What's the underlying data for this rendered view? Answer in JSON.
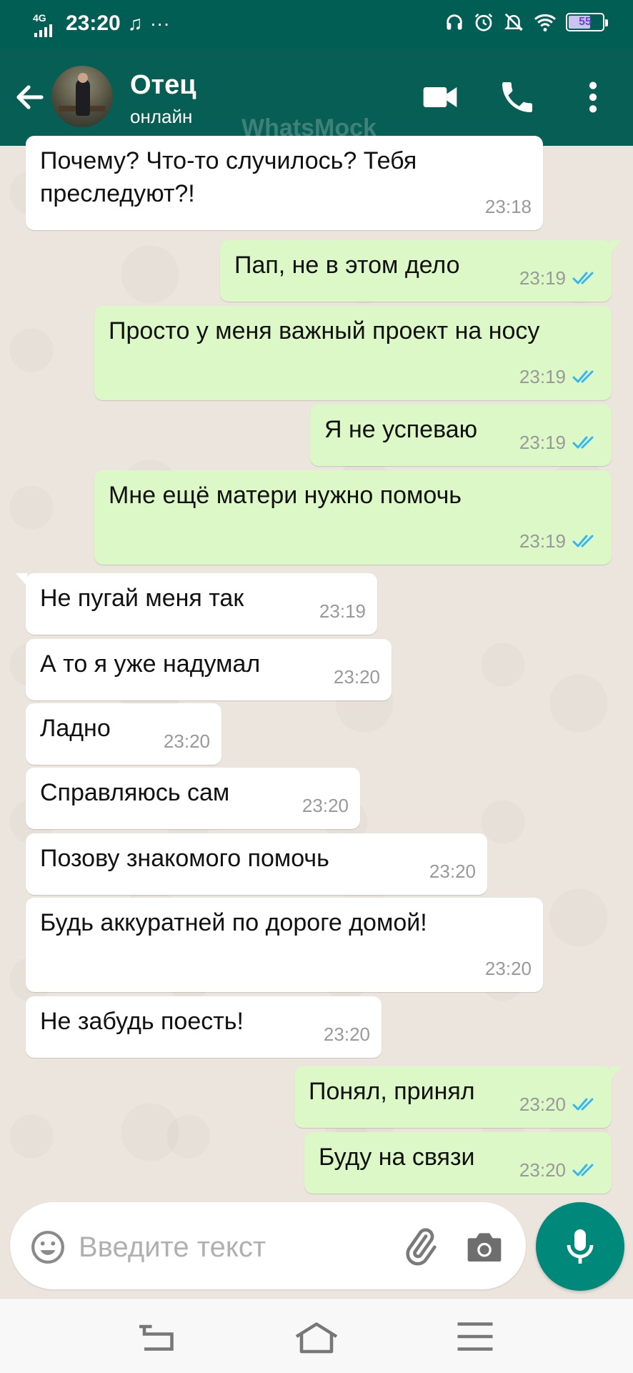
{
  "status_bar": {
    "network": "4G",
    "time": "23:20",
    "music_icon": "music-note-icon",
    "more": "···",
    "battery": "55"
  },
  "header": {
    "contact_name": "Отец",
    "contact_status": "онлайн",
    "watermark": "WhatsMock",
    "icons": [
      "back-arrow-icon",
      "video-call-icon",
      "phone-call-icon",
      "more-vertical-icon"
    ],
    "color": "#075e54"
  },
  "messages": [
    {
      "dir": "in",
      "text": "Почему? Что-то случилось? Тебя преследуют?!",
      "time": "23:18"
    },
    {
      "dir": "out",
      "text": "Пап, не в этом дело",
      "time": "23:19"
    },
    {
      "dir": "out",
      "text": "Просто у меня важный проект на носу",
      "time": "23:19"
    },
    {
      "dir": "out",
      "text": "Я не успеваю",
      "time": "23:19"
    },
    {
      "dir": "out",
      "text": "Мне ещё матери нужно помочь",
      "time": "23:19"
    },
    {
      "dir": "in",
      "text": "Не пугай меня так",
      "time": "23:19"
    },
    {
      "dir": "in",
      "text": "А то я уже надумал",
      "time": "23:20"
    },
    {
      "dir": "in",
      "text": "Ладно",
      "time": "23:20"
    },
    {
      "dir": "in",
      "text": "Справляюсь сам",
      "time": "23:20"
    },
    {
      "dir": "in",
      "text": "Позову знакомого помочь",
      "time": "23:20"
    },
    {
      "dir": "in",
      "text": "Будь аккуратней по дороге домой!",
      "time": "23:20"
    },
    {
      "dir": "in",
      "text": "Не забудь поесть!",
      "time": "23:20"
    },
    {
      "dir": "out",
      "text": "Понял, принял",
      "time": "23:20"
    },
    {
      "dir": "out",
      "text": "Буду на связи",
      "time": "23:20"
    }
  ],
  "composer": {
    "placeholder": "Введите текст",
    "icons": [
      "emoji-icon",
      "attach-icon",
      "camera-icon",
      "mic-icon"
    ],
    "mic_color": "#00897b"
  },
  "nav": {
    "icons": [
      "back-icon",
      "home-icon",
      "menu-icon"
    ]
  }
}
